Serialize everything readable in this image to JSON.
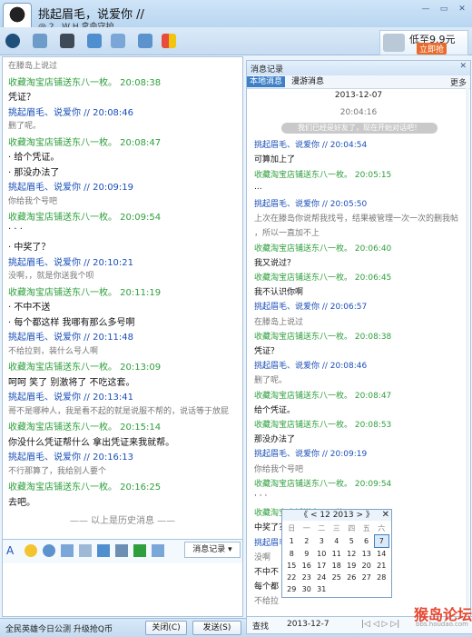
{
  "window": {
    "title": "挑起眉毛，说爱你 //",
    "subtitle": "@ 2 . W H  拿命守护",
    "buttons": [
      "—",
      "▭",
      "✕"
    ]
  },
  "ad": {
    "line1": "低至9.9元",
    "line2": "立即抢"
  },
  "left_chat": {
    "messages": [
      {
        "type": "gray",
        "text": "在滕岛上说过"
      },
      {
        "type": "green",
        "text": "收藏淘宝店铺送东八一枚。  20:08:38"
      },
      {
        "type": "text",
        "text": "凭证？"
      },
      {
        "type": "blue",
        "text": "挑起眉毛、说爱你 //  20:08:46"
      },
      {
        "type": "gray",
        "text": "删了呢。"
      },
      {
        "type": "green",
        "text": "收藏淘宝店铺送东八一枚。  20:08:47"
      },
      {
        "type": "text",
        "text": "· 给个凭证。"
      },
      {
        "type": "text",
        "text": "· 那没办法了"
      },
      {
        "type": "blue",
        "text": "挑起眉毛、说爱你 //  20:09:19"
      },
      {
        "type": "gray",
        "text": "你给我个号吧"
      },
      {
        "type": "green",
        "text": "收藏淘宝店铺送东八一枚。  20:09:54"
      },
      {
        "type": "text",
        "text": "· · ·"
      },
      {
        "type": "text",
        "text": "· 中奖了？"
      },
      {
        "type": "blue",
        "text": "挑起眉毛、说爱你 //  20:10:21"
      },
      {
        "type": "gray",
        "text": "没啊，，就是你送我个呗"
      },
      {
        "type": "green",
        "text": "收藏淘宝店铺送东八一枚。  20:11:19"
      },
      {
        "type": "text",
        "text": "· 不中不送"
      },
      {
        "type": "text",
        "text": "· 每个都这样 我哪有那么多号啊"
      },
      {
        "type": "blue",
        "text": "挑起眉毛、说爱你 //  20:11:48"
      },
      {
        "type": "gray",
        "text": "不给拉到，装什么号人啊"
      },
      {
        "type": "green",
        "text": "收藏淘宝店铺送东八一枚。  20:13:09"
      },
      {
        "type": "text",
        "text": "呵呵  笑了  别激将了  不吃这套。"
      },
      {
        "type": "blue",
        "text": "挑起眉毛、说爱你 //  20:13:41"
      },
      {
        "type": "gray",
        "text": "哥不是哪种人，我是看不起的就是说服不帮的，说话等于放屁"
      },
      {
        "type": "green",
        "text": "收藏淘宝店铺送东八一枚。  20:15:14"
      },
      {
        "type": "text",
        "text": "你没什么凭证帮什么   拿出凭证来我就帮。"
      },
      {
        "type": "blue",
        "text": "挑起眉毛、说爱你 //  20:16:13"
      },
      {
        "type": "gray",
        "text": "不行那算了，我给别人要个"
      },
      {
        "type": "green",
        "text": "收藏淘宝店铺送东八一枚。  20:16:25"
      },
      {
        "type": "text",
        "text": "去吧。"
      }
    ],
    "history_note": "—— 以上是历史消息 ——"
  },
  "composer": {
    "records_label": "消息记录 ▾"
  },
  "bottom": {
    "left_text": "全民英雄今日公测 升级抢Q币",
    "close": "关闭(C)",
    "send": "发送(S)"
  },
  "records": {
    "header": "消息记录",
    "tabs": [
      "本地消息",
      "漫游消息"
    ],
    "more": "更多",
    "date": "2013-12-07",
    "items": [
      {
        "type": "center",
        "text": "20:04:16"
      },
      {
        "type": "bubble",
        "text": "我们已经是好友了，现在开始对话吧！"
      },
      {
        "type": "blue",
        "text": "挑起眉毛、说爱你 // 20:04:54"
      },
      {
        "type": "text",
        "text": "可算加上了"
      },
      {
        "type": "green",
        "text": "收藏淘宝店铺送东八一枚。 20:05:15"
      },
      {
        "type": "text",
        "text": "..."
      },
      {
        "type": "blue",
        "text": "挑起眉毛、说爱你 // 20:05:50"
      },
      {
        "type": "gray",
        "text": "上次在滕岛你说帮我找号，结果被管理一次一次的删我帖"
      },
      {
        "type": "gray",
        "text": "，所以一直加不上"
      },
      {
        "type": "green",
        "text": "收藏淘宝店铺送东八一枚。 20:06:40"
      },
      {
        "type": "text",
        "text": "我又说过？"
      },
      {
        "type": "green",
        "text": "收藏淘宝店铺送东八一枚。 20:06:45"
      },
      {
        "type": "text",
        "text": "我不认识你啊"
      },
      {
        "type": "blue",
        "text": "挑起眉毛、说爱你 // 20:06:57"
      },
      {
        "type": "gray",
        "text": "在滕岛上说过"
      },
      {
        "type": "green",
        "text": "收藏淘宝店铺送东八一枚。 20:08:38"
      },
      {
        "type": "text",
        "text": "凭证？"
      },
      {
        "type": "blue",
        "text": "挑起眉毛、说爱你 // 20:08:46"
      },
      {
        "type": "gray",
        "text": "删了呢。"
      },
      {
        "type": "green",
        "text": "收藏淘宝店铺送东八一枚。 20:08:47"
      },
      {
        "type": "text",
        "text": "给个凭证。"
      },
      {
        "type": "green",
        "text": "收藏淘宝店铺送东八一枚。 20:08:53"
      },
      {
        "type": "text",
        "text": "那没办法了"
      },
      {
        "type": "blue",
        "text": "挑起眉毛、说爱你 // 20:09:19"
      },
      {
        "type": "gray",
        "text": "你给我个号吧"
      },
      {
        "type": "green",
        "text": "收藏淘宝店铺送东八一枚。 20:09:54"
      },
      {
        "type": "text",
        "text": "· · ·"
      },
      {
        "type": "green",
        "text": "收藏淘宝店铺送东八一枚。 20:10:04"
      },
      {
        "type": "text",
        "text": "中奖了？"
      },
      {
        "type": "blue",
        "text": "挑起眉毛、说爱你 // 20:10:21"
      },
      {
        "type": "gray",
        "text": "没啊"
      },
      {
        "type": "text",
        "text": "不中不"
      },
      {
        "type": "text",
        "text": "每个都"
      },
      {
        "type": "gray",
        "text": "不给拉"
      }
    ]
  },
  "calendar": {
    "header": "《  <     12  2013     >  》",
    "weekdays": [
      "日",
      "一",
      "二",
      "三",
      "四",
      "五",
      "六"
    ],
    "weeks": [
      [
        "1",
        "2",
        "3",
        "4",
        "5",
        "6",
        "7"
      ],
      [
        "8",
        "9",
        "10",
        "11",
        "12",
        "13",
        "14"
      ],
      [
        "15",
        "16",
        "17",
        "18",
        "19",
        "20",
        "21"
      ],
      [
        "22",
        "23",
        "24",
        "25",
        "26",
        "27",
        "28"
      ],
      [
        "29",
        "30",
        "31",
        "",
        "",
        "",
        ""
      ]
    ],
    "highlight": "7"
  },
  "records_footer": {
    "search": "查找",
    "date": "2013-12-7",
    "nav": "|◁  ◁  ▷  ▷|",
    "watermark": "猴岛论坛",
    "watermark_sub": "bbs.houdao.com"
  }
}
